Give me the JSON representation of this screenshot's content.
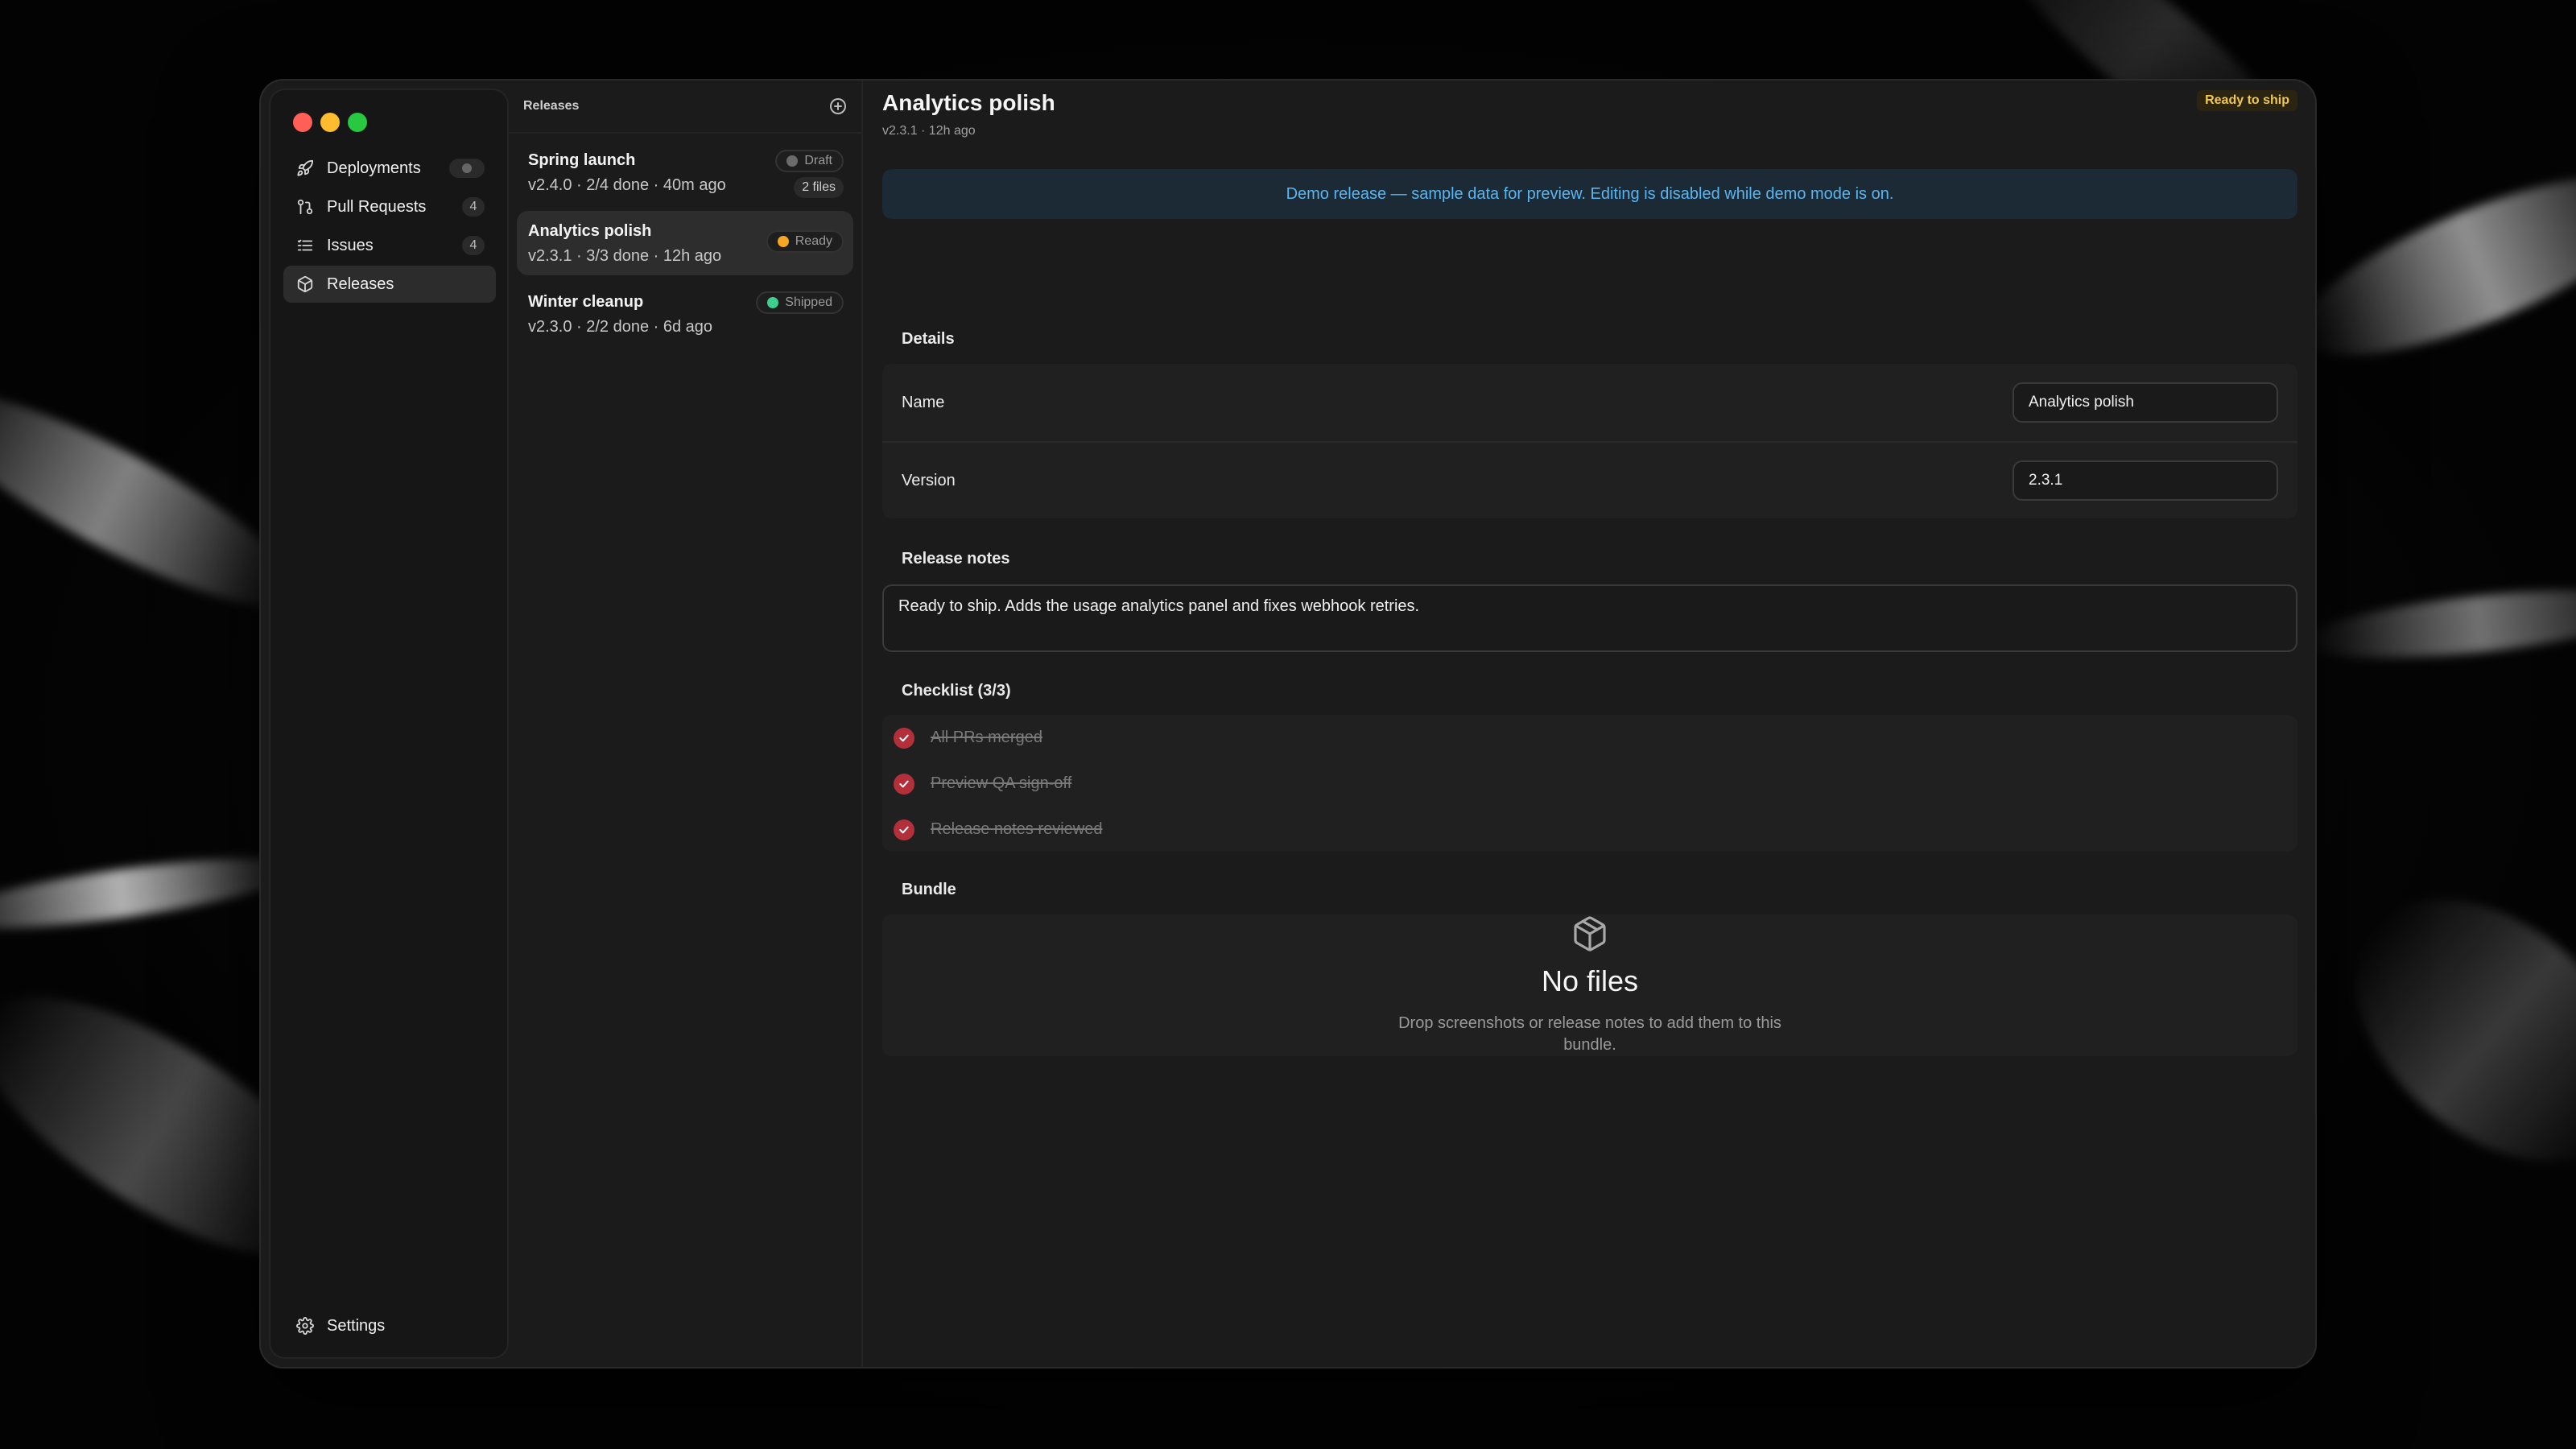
{
  "sidebar": {
    "items": [
      {
        "label": "Deployments",
        "icon": "rocket-icon",
        "badge": ""
      },
      {
        "label": "Pull Requests",
        "icon": "git-pull-request-icon",
        "badge": "4"
      },
      {
        "label": "Issues",
        "icon": "list-icon",
        "badge": "4"
      },
      {
        "label": "Releases",
        "icon": "package-icon",
        "badge": "",
        "active": true
      }
    ],
    "settings_label": "Settings"
  },
  "list": {
    "title": "Releases",
    "releases": [
      {
        "name": "Spring launch",
        "meta": "v2.4.0 · 2/4 done · 40m ago",
        "status": "Draft",
        "status_color": "#6b6b6b",
        "files": "2 files"
      },
      {
        "name": "Analytics polish",
        "meta": "v2.3.1 · 3/3 done · 12h ago",
        "status": "Ready",
        "status_color": "#f5a623"
      },
      {
        "name": "Winter cleanup",
        "meta": "v2.3.0 · 2/2 done · 6d ago",
        "status": "Shipped",
        "status_color": "#3ecf8e"
      }
    ]
  },
  "detail": {
    "title": "Analytics polish",
    "subtitle": "v2.3.1 · 12h ago",
    "status": "Ready to ship",
    "banner": "Demo release — sample data for preview. Editing is disabled while demo mode is on.",
    "details_label": "Details",
    "name_label": "Name",
    "name_value": "Analytics polish",
    "version_label": "Version",
    "version_value": "2.3.1",
    "notes_label": "Release notes",
    "notes_value": "Ready to ship. Adds the usage analytics panel and fixes webhook retries.",
    "checklist_label": "Checklist (3/3)",
    "checklist": [
      "All PRs merged",
      "Preview QA sign-off",
      "Release notes reviewed"
    ],
    "bundle_label": "Bundle",
    "bundle_title": "No files",
    "bundle_text": "Drop screenshots or release notes to add them to this bundle."
  },
  "colors": {
    "accent": "#5bb5f0",
    "check": "#b3303b",
    "ready": "#f2c94c"
  }
}
